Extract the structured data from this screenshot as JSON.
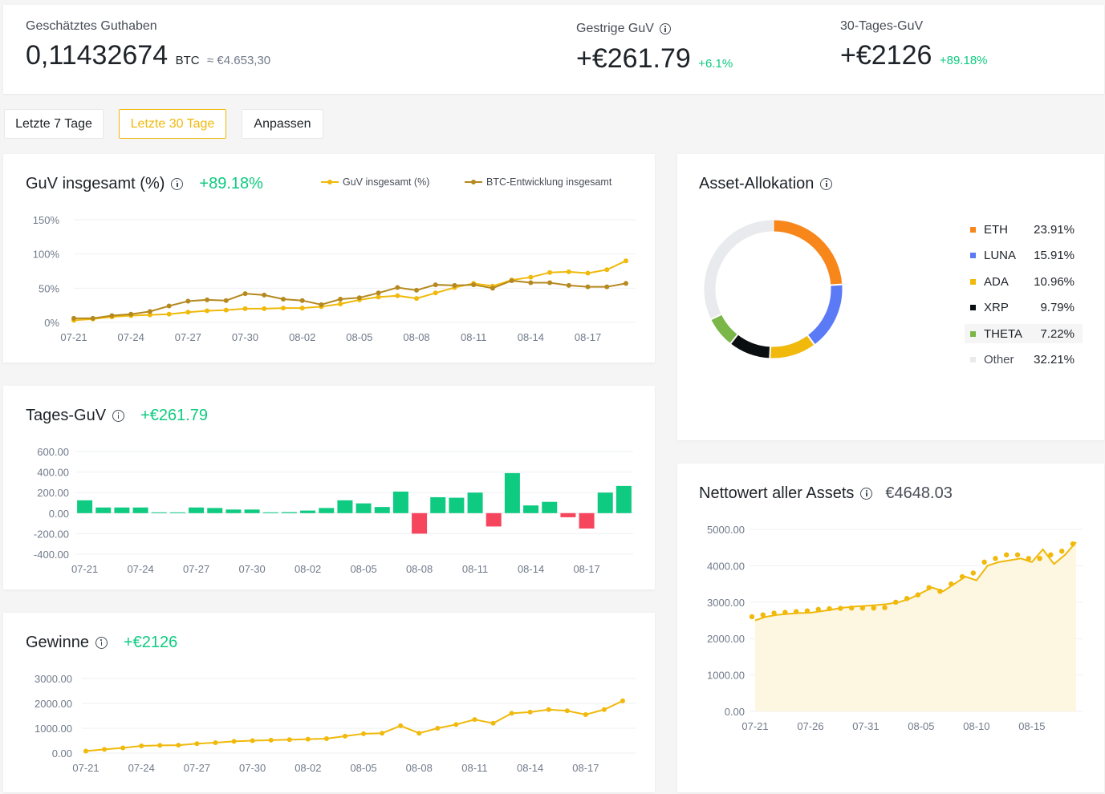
{
  "header": {
    "balance_label": "Geschätztes Guthaben",
    "balance_value": "0,11432674",
    "balance_unit": "BTC",
    "balance_fiat": "≈ €4.653,30",
    "yesterday_label": "Gestrige GuV",
    "yesterday_value": "+€261.79",
    "yesterday_pct": "+6.1%",
    "month_label": "30-Tages-GuV",
    "month_value": "+€2126",
    "month_pct": "+89.18%"
  },
  "periods": {
    "last7": "Letzte 7 Tage",
    "last30": "Letzte 30 Tage",
    "custom": "Anpassen"
  },
  "colors": {
    "accent": "#f0b90b",
    "btc_line": "#b5891f",
    "profit": "#0ecb81",
    "loss": "#f6465d",
    "eth": "#f7861b",
    "luna": "#5b7af5",
    "ada": "#f0b90b",
    "xrp": "#0b0e11",
    "theta": "#7ab648",
    "other": "#e8eaed"
  },
  "cards": {
    "pnl_title": "GuV insgesamt (%)",
    "pnl_value": "+89.18%",
    "daily_title": "Tages-GuV",
    "daily_value": "+€261.79",
    "profit_title": "Gewinne",
    "profit_value": "+€2126",
    "alloc_title": "Asset-Allokation",
    "net_title": "Nettowert aller Assets",
    "net_value": "€4648.03"
  },
  "chart_data": [
    {
      "id": "pnl",
      "type": "line",
      "title": "GuV insgesamt (%)",
      "x": [
        "07-21",
        "07-22",
        "07-23",
        "07-24",
        "07-25",
        "07-26",
        "07-27",
        "07-28",
        "07-29",
        "07-30",
        "07-31",
        "08-01",
        "08-02",
        "08-03",
        "08-04",
        "08-05",
        "08-06",
        "08-07",
        "08-08",
        "08-09",
        "08-10",
        "08-11",
        "08-12",
        "08-13",
        "08-14",
        "08-15",
        "08-16",
        "08-17",
        "08-18",
        "08-19"
      ],
      "tick_labels": [
        "07-21",
        "07-24",
        "07-27",
        "07-30",
        "08-02",
        "08-05",
        "08-08",
        "08-11",
        "08-14",
        "08-17"
      ],
      "yticks": [
        "0%",
        "50%",
        "100%",
        "150%"
      ],
      "ylim": [
        0,
        150
      ],
      "legend": [
        "GuV insgesamt (%)",
        "BTC-Entwicklung insgesamt"
      ],
      "series": [
        {
          "name": "GuV insgesamt (%)",
          "values": [
            3,
            5,
            8,
            10,
            11,
            12,
            15,
            17,
            18,
            20,
            20,
            21,
            21,
            23,
            27,
            33,
            37,
            39,
            35,
            43,
            51,
            57,
            53,
            62,
            66,
            73,
            74,
            72,
            77,
            90
          ]
        },
        {
          "name": "BTC-Entwicklung insgesamt",
          "values": [
            6,
            6,
            10,
            12,
            16,
            24,
            31,
            33,
            32,
            42,
            40,
            34,
            32,
            26,
            34,
            36,
            43,
            51,
            47,
            55,
            54,
            55,
            50,
            61,
            58,
            58,
            54,
            52,
            52,
            57
          ]
        }
      ]
    },
    {
      "id": "daily",
      "type": "bar",
      "title": "Tages-GuV",
      "x": [
        "07-21",
        "07-22",
        "07-23",
        "07-24",
        "07-25",
        "07-26",
        "07-27",
        "07-28",
        "07-29",
        "07-30",
        "07-31",
        "08-01",
        "08-02",
        "08-03",
        "08-04",
        "08-05",
        "08-06",
        "08-07",
        "08-08",
        "08-09",
        "08-10",
        "08-11",
        "08-12",
        "08-13",
        "08-14",
        "08-15",
        "08-16",
        "08-17",
        "08-18",
        "08-19"
      ],
      "tick_labels": [
        "07-21",
        "07-24",
        "07-27",
        "07-30",
        "08-02",
        "08-05",
        "08-08",
        "08-11",
        "08-14",
        "08-17"
      ],
      "yticks": [
        "-400.00",
        "-200.00",
        "0.00",
        "200.00",
        "400.00",
        "600.00"
      ],
      "ylim": [
        -400,
        600
      ],
      "values": [
        125,
        55,
        55,
        55,
        8,
        5,
        55,
        50,
        35,
        35,
        8,
        10,
        25,
        50,
        125,
        95,
        60,
        210,
        -200,
        155,
        150,
        200,
        -130,
        390,
        75,
        110,
        -40,
        -150,
        200,
        265
      ]
    },
    {
      "id": "profit",
      "type": "line",
      "title": "Gewinne",
      "x": [
        "07-21",
        "07-22",
        "07-23",
        "07-24",
        "07-25",
        "07-26",
        "07-27",
        "07-28",
        "07-29",
        "07-30",
        "07-31",
        "08-01",
        "08-02",
        "08-03",
        "08-04",
        "08-05",
        "08-06",
        "08-07",
        "08-08",
        "08-09",
        "08-10",
        "08-11",
        "08-12",
        "08-13",
        "08-14",
        "08-15",
        "08-16",
        "08-17",
        "08-18",
        "08-19"
      ],
      "tick_labels": [
        "07-21",
        "07-24",
        "07-27",
        "07-30",
        "08-02",
        "08-05",
        "08-08",
        "08-11",
        "08-14",
        "08-17"
      ],
      "yticks": [
        "0.00",
        "1000.00",
        "2000.00",
        "3000.00"
      ],
      "ylim": [
        0,
        3000
      ],
      "values": [
        80,
        150,
        210,
        290,
        310,
        320,
        380,
        420,
        470,
        500,
        520,
        540,
        560,
        580,
        680,
        780,
        800,
        1100,
        800,
        1000,
        1150,
        1350,
        1200,
        1600,
        1650,
        1750,
        1700,
        1550,
        1750,
        2100
      ]
    },
    {
      "id": "alloc",
      "type": "pie",
      "title": "Asset-Allokation",
      "categories": [
        "ETH",
        "LUNA",
        "ADA",
        "XRP",
        "THETA",
        "Other"
      ],
      "values": [
        23.91,
        15.91,
        10.96,
        9.79,
        7.22,
        32.21
      ],
      "labels": [
        "23.91%",
        "15.91%",
        "10.96%",
        "9.79%",
        "7.22%",
        "32.21%"
      ]
    },
    {
      "id": "net",
      "type": "area",
      "title": "Nettowert aller Assets",
      "x": [
        "07-21",
        "07-22",
        "07-23",
        "07-24",
        "07-25",
        "07-26",
        "07-27",
        "07-28",
        "07-29",
        "07-30",
        "07-31",
        "08-01",
        "08-02",
        "08-03",
        "08-04",
        "08-05",
        "08-06",
        "08-07",
        "08-08",
        "08-09",
        "08-10",
        "08-11",
        "08-12",
        "08-13",
        "08-14",
        "08-15",
        "08-16",
        "08-17",
        "08-18",
        "08-19"
      ],
      "tick_labels": [
        "07-21",
        "07-26",
        "07-31",
        "08-05",
        "08-10",
        "08-15"
      ],
      "yticks": [
        "0.00",
        "1000.00",
        "2000.00",
        "3000.00",
        "4000.00",
        "5000.00"
      ],
      "ylim": [
        0,
        5000
      ],
      "values": [
        2500,
        2600,
        2650,
        2680,
        2700,
        2710,
        2750,
        2800,
        2850,
        2880,
        2900,
        2920,
        2950,
        3000,
        3100,
        3250,
        3400,
        3300,
        3500,
        3700,
        3600,
        4000,
        4100,
        4150,
        4200,
        4100,
        4450,
        4050,
        4300,
        4648.03
      ],
      "dots": [
        2600,
        2650,
        2700,
        2720,
        2740,
        2760,
        2800,
        2820,
        2830,
        2840,
        2840,
        2840,
        2850,
        3000,
        3100,
        3200,
        3400,
        3300,
        3500,
        3700,
        3800,
        4100,
        4200,
        4300,
        4300,
        4200,
        4200,
        4300,
        4400,
        4600
      ]
    }
  ]
}
